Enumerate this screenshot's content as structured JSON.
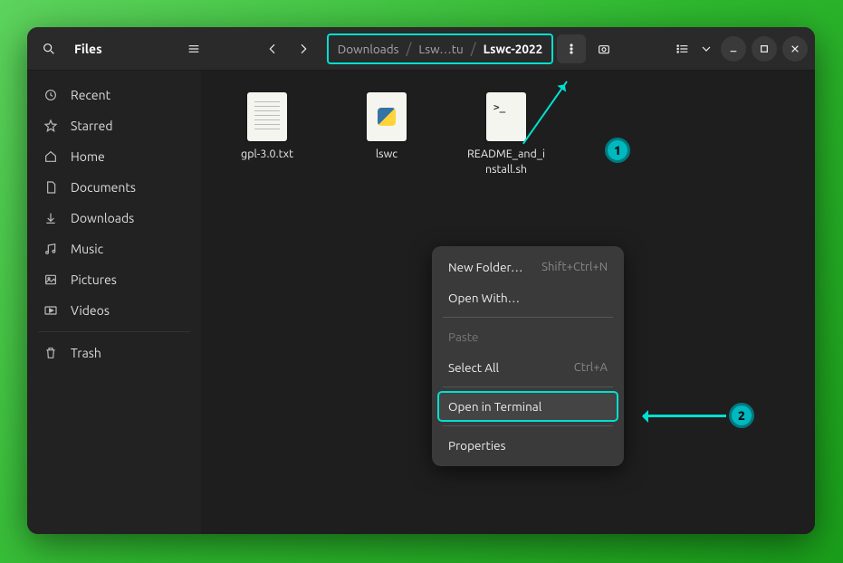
{
  "app_title": "Files",
  "breadcrumb": [
    "Downloads",
    "Lsw…tu",
    "Lswc-2022"
  ],
  "sidebar": {
    "items": [
      {
        "label": "Recent",
        "icon": "clock-icon"
      },
      {
        "label": "Starred",
        "icon": "star-icon"
      },
      {
        "label": "Home",
        "icon": "home-icon"
      },
      {
        "label": "Documents",
        "icon": "document-icon"
      },
      {
        "label": "Downloads",
        "icon": "download-icon"
      },
      {
        "label": "Music",
        "icon": "music-icon"
      },
      {
        "label": "Pictures",
        "icon": "picture-icon"
      },
      {
        "label": "Videos",
        "icon": "video-icon"
      },
      {
        "label": "Trash",
        "icon": "trash-icon"
      }
    ]
  },
  "files": [
    {
      "name": "gpl-3.0.txt",
      "type": "text"
    },
    {
      "name": "lswc",
      "type": "python"
    },
    {
      "name": "README_and_install.sh",
      "type": "shell"
    }
  ],
  "context_menu": {
    "items": [
      {
        "label": "New Folder…",
        "shortcut": "Shift+Ctrl+N",
        "enabled": true
      },
      {
        "label": "Open With…",
        "shortcut": "",
        "enabled": true
      },
      {
        "sep": true
      },
      {
        "label": "Paste",
        "shortcut": "",
        "enabled": false
      },
      {
        "label": "Select All",
        "shortcut": "Ctrl+A",
        "enabled": true
      },
      {
        "sep": true
      },
      {
        "label": "Open in Terminal",
        "shortcut": "",
        "enabled": true,
        "highlighted": true
      },
      {
        "sep": true
      },
      {
        "label": "Properties",
        "shortcut": "",
        "enabled": true
      }
    ]
  },
  "annotations": {
    "badge1": "1",
    "badge2": "2"
  },
  "colors": {
    "accent": "#00e0d0",
    "badge_bg": "#00b8bf"
  }
}
